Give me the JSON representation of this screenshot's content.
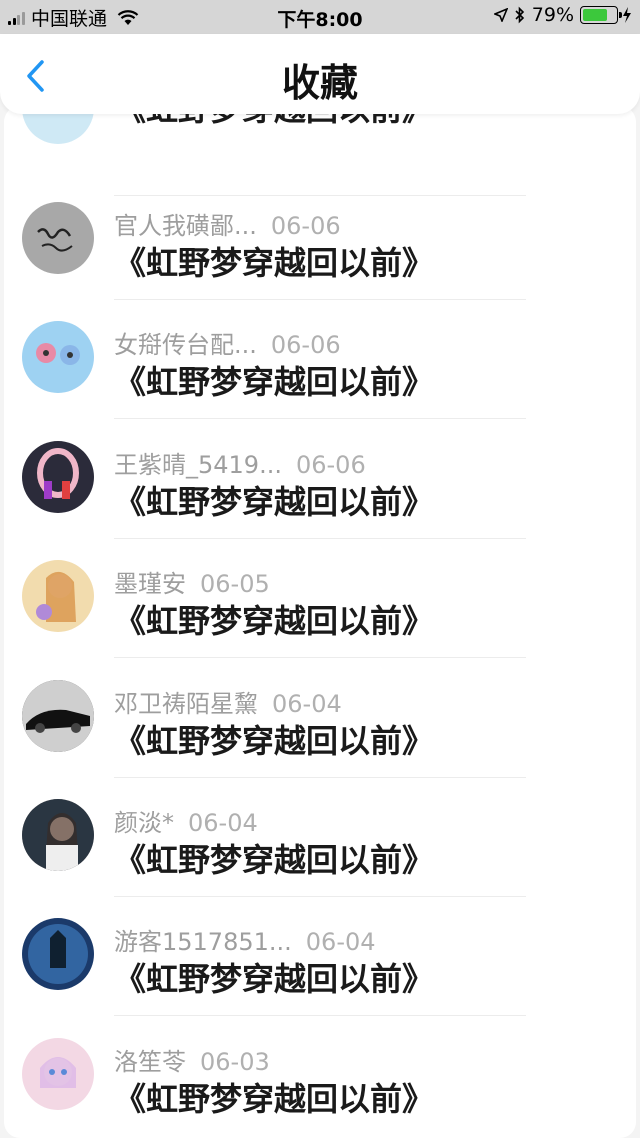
{
  "status_bar": {
    "carrier": "中国联通",
    "time": "下午8:00",
    "battery": "79%",
    "battery_level": 0.79,
    "icons": [
      "signal-icon",
      "wifi-icon",
      "location-icon",
      "bluetooth-icon",
      "battery-icon",
      "charging-icon"
    ]
  },
  "header": {
    "title": "收藏",
    "back_icon": "chevron-left-icon",
    "accent": "#2196f3"
  },
  "items": [
    {
      "name": "",
      "date": "",
      "text": "《虹野梦穿越回以前》",
      "avatar_color": "#cfe9f5"
    },
    {
      "name": "官人我磺鄙...",
      "date": "06-06",
      "text": "《虹野梦穿越回以前》",
      "avatar_color": "#a8a8a8"
    },
    {
      "name": "女搿传台配...",
      "date": "06-06",
      "text": "《虹野梦穿越回以前》",
      "avatar_color": "#9ed2f2"
    },
    {
      "name": "王紫晴_5419...",
      "date": "06-06",
      "text": "《虹野梦穿越回以前》",
      "avatar_color": "#2b2b3a"
    },
    {
      "name": "墨瑾安",
      "date": "06-05",
      "text": "《虹野梦穿越回以前》",
      "avatar_color": "#f2dcae"
    },
    {
      "name": "邓卫祷陌星黧",
      "date": "06-04",
      "text": "《虹野梦穿越回以前》",
      "avatar_color": "#3a3a3a"
    },
    {
      "name": "颜淡*",
      "date": "06-04",
      "text": "《虹野梦穿越回以前》",
      "avatar_color": "#dcc8be"
    },
    {
      "name": "游客1517851...",
      "date": "06-04",
      "text": "《虹野梦穿越回以前》",
      "avatar_color": "#1b3a6a"
    },
    {
      "name": "洛笙苓",
      "date": "06-03",
      "text": "《虹野梦穿越回以前》",
      "avatar_color": "#f3d8e4"
    }
  ]
}
